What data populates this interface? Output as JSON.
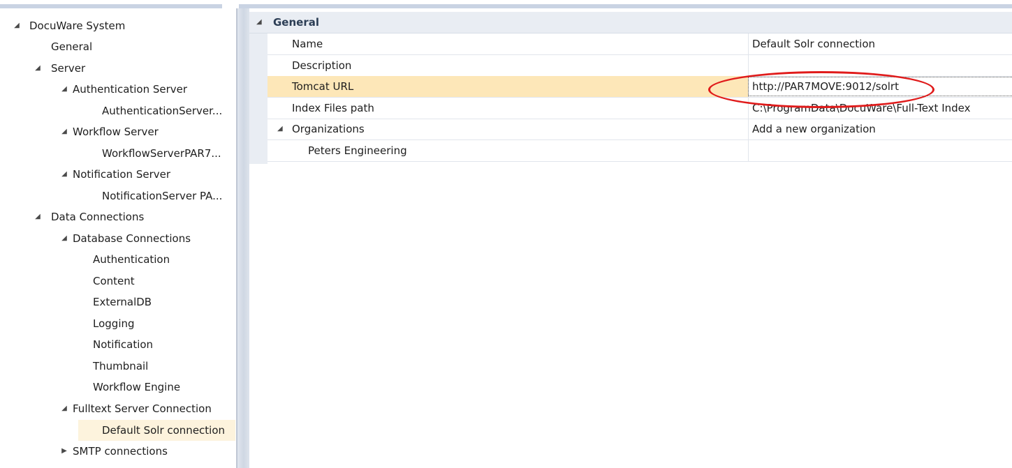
{
  "tree": {
    "root": "DocuWare System",
    "general": "General",
    "server": "Server",
    "auth_server": "Authentication Server",
    "auth_server_child": "AuthenticationServer...",
    "workflow_server": "Workflow Server",
    "workflow_server_child": "WorkflowServerPAR7...",
    "notification_server": "Notification Server",
    "notification_server_child": "NotificationServer PA...",
    "data_connections": "Data Connections",
    "database_connections": "Database Connections",
    "db_items": [
      "Authentication",
      "Content",
      "ExternalDB",
      "Logging",
      "Notification",
      "Thumbnail",
      "Workflow Engine"
    ],
    "fulltext": "Fulltext Server Connection",
    "fulltext_child": "Default Solr connection",
    "smtp": "SMTP connections"
  },
  "grid": {
    "category": "General",
    "rows": [
      {
        "name": "Name",
        "value": "Default Solr connection"
      },
      {
        "name": "Description",
        "value": ""
      },
      {
        "name": "Tomcat URL",
        "value": "http://PAR7MOVE:9012/solrt"
      },
      {
        "name": "Index Files path",
        "value": "C:\\ProgramData\\DocuWare\\Full-Text Index"
      },
      {
        "name": "Organizations",
        "value": "Add a new organization"
      },
      {
        "name": "Peters Engineering",
        "value": ""
      }
    ]
  },
  "colors": {
    "selected_tree_bg": "#fdf3dd",
    "selected_row_bg": "#fde7b8",
    "annotation": "#e01b1b"
  },
  "icons": {
    "expanded": "triangle-expanded-icon",
    "collapsed": "triangle-collapsed-icon"
  }
}
